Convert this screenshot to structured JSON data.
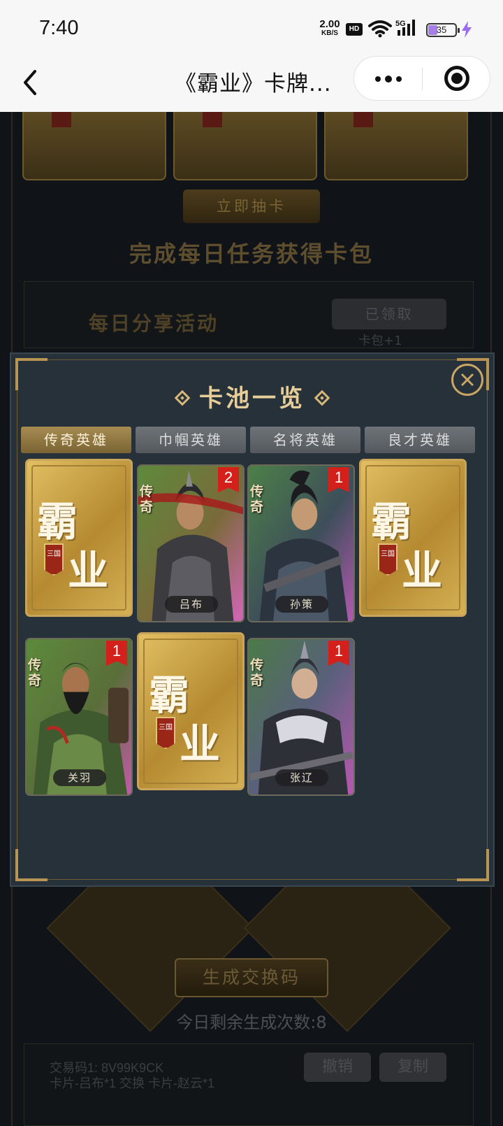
{
  "status_bar": {
    "time": "7:40",
    "net_speed_value": "2.00",
    "net_speed_unit": "KB/S",
    "hd": "HD",
    "network": "5G",
    "battery": "35",
    "battery_level": 0.35,
    "icons": [
      "wifi-icon",
      "signal-icon",
      "charging-bolt-icon"
    ]
  },
  "nav": {
    "title": "《霸业》卡牌...",
    "icons": [
      "back-arrow-icon",
      "more-dots-icon",
      "close-target-icon"
    ]
  },
  "background": {
    "draw_button": "立即抽卡",
    "daily_heading": "完成每日任务获得卡包",
    "task_title": "每日分享活动",
    "task_button": "已领取",
    "task_reward": "卡包+1",
    "generate_button": "生成交换码",
    "remaining": "今日剩余生成次数:8",
    "trade_code": "交易码1:   8V99K9CK",
    "trade_detail": "卡片-吕布*1 交换 卡片-赵云*1",
    "revoke_button": "撤销",
    "copy_button": "复制"
  },
  "modal": {
    "title": "卡池一览",
    "tabs": [
      {
        "label": "传奇英雄",
        "active": true
      },
      {
        "label": "巾帼英雄",
        "active": false
      },
      {
        "label": "名将英雄",
        "active": false
      },
      {
        "label": "良才英雄",
        "active": false
      }
    ],
    "card_logo": {
      "top": "霸",
      "bottom": "业",
      "seal": "三国"
    },
    "cards": [
      {
        "type": "locked"
      },
      {
        "type": "hero",
        "name": "吕布",
        "rarity": "传奇",
        "count": "2"
      },
      {
        "type": "hero",
        "name": "孙策",
        "rarity": "传奇",
        "count": "1"
      },
      {
        "type": "locked"
      },
      {
        "type": "hero",
        "name": "关羽",
        "rarity": "传奇",
        "count": "1"
      },
      {
        "type": "locked"
      },
      {
        "type": "hero",
        "name": "张辽",
        "rarity": "传奇",
        "count": "1"
      }
    ]
  },
  "colors": {
    "gold_accent": "#e6cd9a",
    "active_tab": "#a68b52",
    "count_badge": "#d3201a",
    "battery_fill": "#a57ee8"
  }
}
